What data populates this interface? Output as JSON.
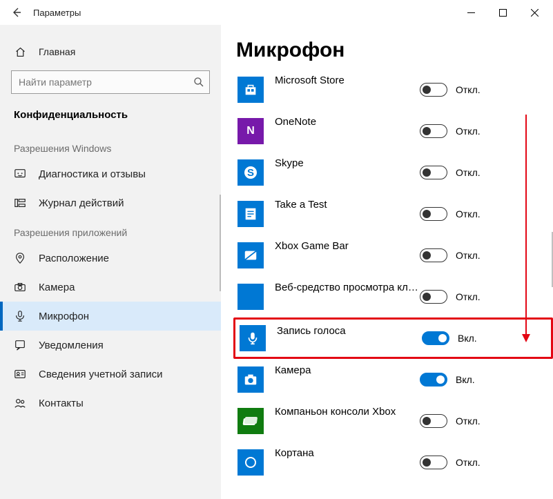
{
  "window": {
    "title": "Параметры"
  },
  "sidebar": {
    "home": "Главная",
    "search_placeholder": "Найти параметр",
    "section": "Конфиденциальность",
    "group_windows": "Разрешения Windows",
    "group_apps": "Разрешения приложений",
    "windows_items": [
      {
        "label": "Диагностика и отзывы"
      },
      {
        "label": "Журнал действий"
      }
    ],
    "app_items": [
      {
        "label": "Расположение"
      },
      {
        "label": "Камера"
      },
      {
        "label": "Микрофон"
      },
      {
        "label": "Уведомления"
      },
      {
        "label": "Сведения учетной записи"
      },
      {
        "label": "Контакты"
      }
    ]
  },
  "content": {
    "heading": "Микрофон",
    "labels": {
      "on": "Вкл.",
      "off": "Откл."
    },
    "apps": [
      {
        "name": "Microsoft Store",
        "state": "off",
        "icon": "store",
        "color": "blue"
      },
      {
        "name": "OneNote",
        "state": "off",
        "icon": "onenote",
        "color": "purple"
      },
      {
        "name": "Skype",
        "state": "off",
        "icon": "skype",
        "color": "blue"
      },
      {
        "name": "Take a Test",
        "state": "off",
        "icon": "test",
        "color": "blue"
      },
      {
        "name": "Xbox Game Bar",
        "state": "off",
        "icon": "xbox",
        "color": "blue"
      },
      {
        "name": "Веб-средство просмотра класси...",
        "state": "off",
        "icon": "blank",
        "color": "blue"
      },
      {
        "name": "Запись голоса",
        "state": "on",
        "icon": "voice",
        "color": "blue",
        "highlight": true
      },
      {
        "name": "Камера",
        "state": "on",
        "icon": "camera",
        "color": "blue"
      },
      {
        "name": "Компаньон консоли Xbox",
        "state": "off",
        "icon": "xboxcomp",
        "color": "green"
      },
      {
        "name": "Кортана",
        "state": "off",
        "icon": "cortana",
        "color": "blue"
      }
    ]
  }
}
